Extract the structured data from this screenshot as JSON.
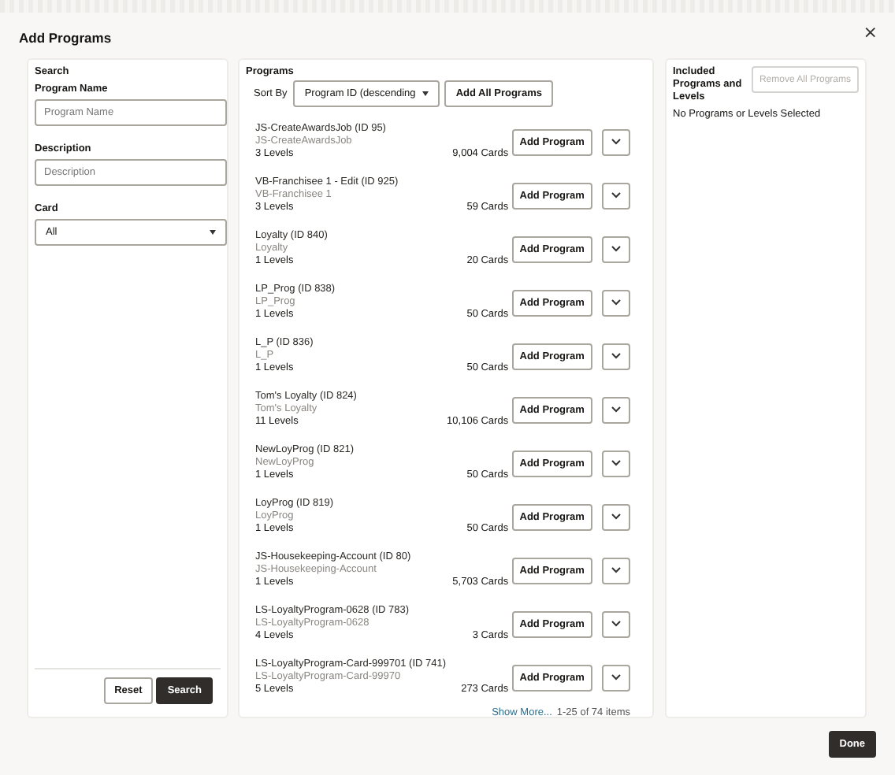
{
  "dialog": {
    "title": "Add Programs",
    "close": "×"
  },
  "search_panel": {
    "heading": "Search",
    "fields": [
      {
        "kind": "text",
        "label": "Program Name",
        "placeholder": "Program Name"
      },
      {
        "kind": "text",
        "label": "Description",
        "placeholder": "Description"
      },
      {
        "kind": "select",
        "label": "Card",
        "value": "All"
      }
    ],
    "buttons": [
      {
        "label": "Reset",
        "primary": false
      },
      {
        "label": "Search",
        "primary": true
      }
    ]
  },
  "programs_panel": {
    "heading": "Programs",
    "sort_label": "Sort By",
    "sort_value": "Program ID (descending",
    "add_all": "Add All Programs",
    "rows": [
      {
        "name": "JS-CreateAwardsJob (ID 95)",
        "description": "JS-CreateAwardsJob",
        "levels": "3 Levels",
        "cards": "9,004 Cards",
        "button": "Add Program"
      },
      {
        "name": "VB-Franchisee 1 - Edit (ID 925)",
        "description": "VB-Franchisee 1",
        "levels": "3 Levels",
        "cards": "59 Cards",
        "button": "Add Program"
      },
      {
        "name": "Loyalty (ID 840)",
        "description": "Loyalty",
        "levels": "1 Levels",
        "cards": "20 Cards",
        "button": "Add Program"
      },
      {
        "name": "LP_Prog (ID 838)",
        "description": "LP_Prog",
        "levels": "1 Levels",
        "cards": "50 Cards",
        "button": "Add Program"
      },
      {
        "name": "L_P (ID 836)",
        "description": "L_P",
        "levels": "1 Levels",
        "cards": "50 Cards",
        "button": "Add Program"
      },
      {
        "name": "Tom's Loyalty (ID 824)",
        "description": "Tom's Loyalty",
        "levels": "11 Levels",
        "cards": "10,106 Cards",
        "button": "Add Program"
      },
      {
        "name": "NewLoyProg (ID 821)",
        "description": "NewLoyProg",
        "levels": "1 Levels",
        "cards": "50 Cards",
        "button": "Add Program"
      },
      {
        "name": "LoyProg (ID 819)",
        "description": "LoyProg",
        "levels": "1 Levels",
        "cards": "50 Cards",
        "button": "Add Program"
      },
      {
        "name": "JS-Housekeeping-Account (ID 80)",
        "description": "JS-Housekeeping-Account",
        "levels": "1 Levels",
        "cards": "5,703 Cards",
        "button": "Add Program"
      },
      {
        "name": "LS-LoyaltyProgram-0628 (ID 783)",
        "description": "LS-LoyaltyProgram-0628",
        "levels": "4 Levels",
        "cards": "3 Cards",
        "button": "Add Program"
      },
      {
        "name": "LS-LoyaltyProgram-Card-999701 (ID 741)",
        "description": "LS-LoyaltyProgram-Card-99970",
        "levels": "5 Levels",
        "cards": "273 Cards",
        "button": "Add Program"
      }
    ],
    "show_more": "Show More...",
    "count": "1-25 of 74 items"
  },
  "included_panel": {
    "heading": "Included Programs and Levels",
    "remove_button": {
      "label": "Remove All Programs",
      "disabled": true
    },
    "empty_text": "No Programs or Levels Selected"
  },
  "done_button": "Done"
}
